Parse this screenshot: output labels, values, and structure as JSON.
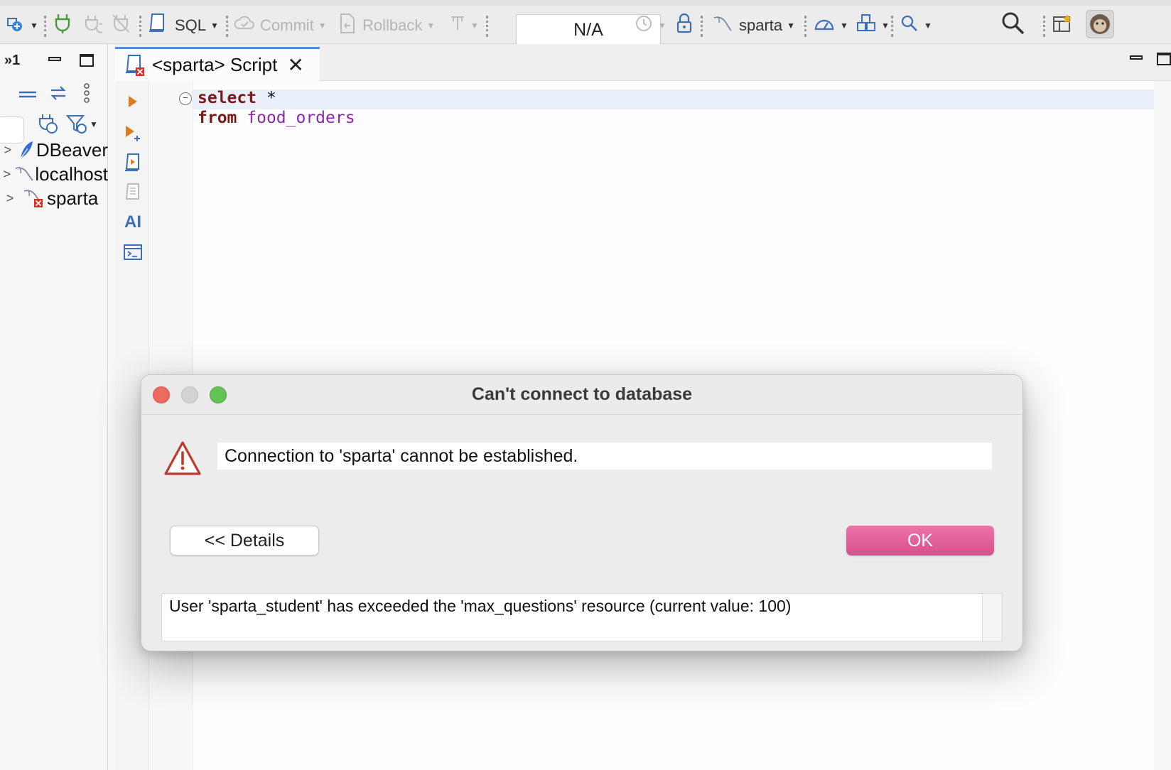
{
  "toolbar": {
    "sql_label": "SQL",
    "commit_label": "Commit",
    "rollback_label": "Rollback",
    "transaction_mode": "N/A",
    "datasource_label": "sparta"
  },
  "navigator": {
    "page_indicator": "»1",
    "tree": [
      {
        "label": "DBeaver",
        "icon": "dbeaver-feather-icon"
      },
      {
        "label": "localhost",
        "icon": "mysql-dolphin-icon"
      },
      {
        "label": "sparta",
        "icon": "mysql-dolphin-error-icon"
      }
    ]
  },
  "editor": {
    "tab_title": "<sparta> Script",
    "code": {
      "line1_keyword": "select",
      "line1_rest": " *",
      "line2_keyword": "from",
      "line2_ident": "food_orders"
    },
    "side_ai_label": "AI"
  },
  "dialog": {
    "title": "Can't connect to database",
    "message": "Connection to 'sparta' cannot be established.",
    "details_button": "<< Details",
    "ok_button": "OK",
    "details_text": "User 'sparta_student' has exceeded the 'max_questions' resource (current value: 100)"
  },
  "colors": {
    "ok_button": "#e0609a",
    "keyword": "#7a1a1a",
    "identifier": "#8a2aa6",
    "warning": "#c0392b",
    "active_tab_accent": "#5a8ad6"
  }
}
